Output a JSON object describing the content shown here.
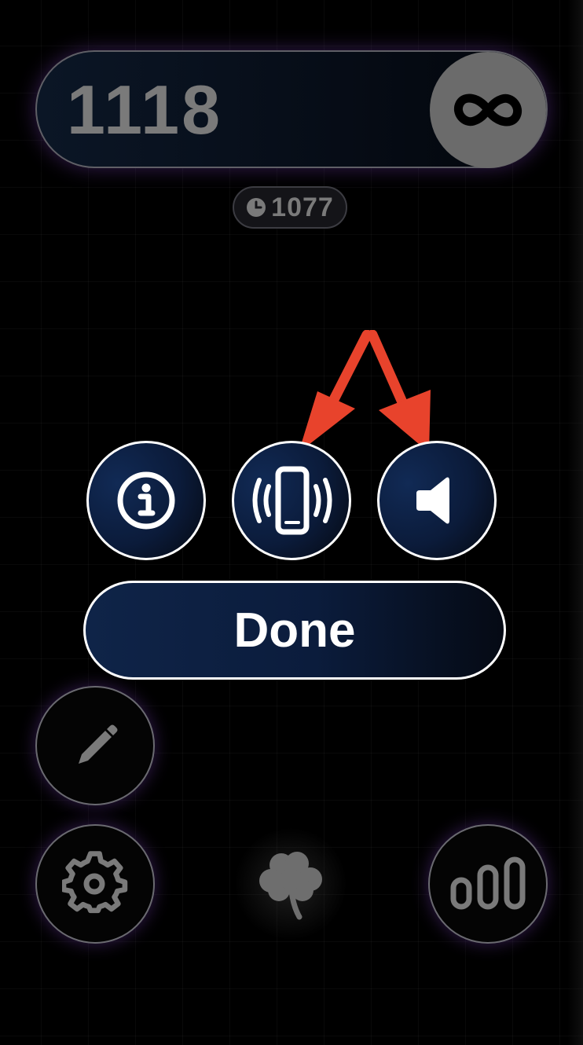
{
  "score": {
    "value": "1118"
  },
  "mode": {
    "icon": "infinity-icon"
  },
  "best": {
    "icon": "clock-icon",
    "value": "1077"
  },
  "settings": {
    "info_icon": "info-icon",
    "vibration_icon": "vibration-phone-icon",
    "sound_icon": "speaker-icon",
    "done_label": "Done"
  },
  "bottom": {
    "edit_icon": "pencil-icon",
    "settings_icon": "gear-icon",
    "center_icon": "shamrock-icon",
    "stats_icon": "stats-bars-icon"
  },
  "colors": {
    "accent_red": "#e8432c",
    "button_navy": "#0b1b3a",
    "score_text": "#7a7a7a",
    "glow_purple": "#6e3caa"
  }
}
